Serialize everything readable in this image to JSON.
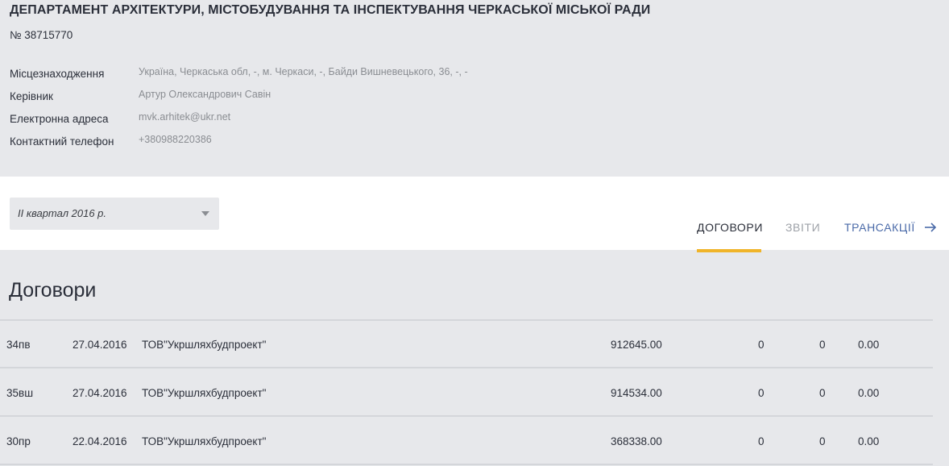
{
  "organization": {
    "title": "ДЕПАРТАМЕНТ АРХІТЕКТУРИ, МІСТОБУДУВАННЯ ТА ІНСПЕКТУВАННЯ ЧЕРКАСЬКОЇ МІСЬКОЇ РАДИ",
    "code": "№ 38715770",
    "details": [
      {
        "label": "Місцезнаходження",
        "value": "Україна, Черкаська обл, -, м. Черкаси, -, Байди Вишневецького, 36, -, -"
      },
      {
        "label": "Керівник",
        "value": "Артур Олександрович Савін"
      },
      {
        "label": "Електронна адреса",
        "value": "mvk.arhitek@ukr.net"
      },
      {
        "label": "Контактний телефон",
        "value": "+380988220386"
      }
    ]
  },
  "filter": {
    "period": "ІІ квартал 2016 р.",
    "caret_icon": "chevron-down-icon"
  },
  "tabs": [
    {
      "label": "ДОГОВОРИ",
      "state": "active",
      "accent": "#f0b429"
    },
    {
      "label": "ЗВІТИ",
      "state": "muted"
    },
    {
      "label": "ТРАНСАКЦІЇ",
      "state": "link",
      "icon": "arrow-right-icon",
      "color": "#4a6aa8"
    }
  ],
  "section": {
    "title": "Договори"
  },
  "contracts": [
    {
      "number": "34пв",
      "date": "27.04.2016",
      "contractor": "ТОВ\"Укршляхбудпроект\"",
      "amount": "912645.00",
      "col_a": "0",
      "col_b": "0",
      "col_c": "0.00"
    },
    {
      "number": "35вш",
      "date": "27.04.2016",
      "contractor": "ТОВ\"Укршляхбудпроект\"",
      "amount": "914534.00",
      "col_a": "0",
      "col_b": "0",
      "col_c": "0.00"
    },
    {
      "number": "30пр",
      "date": "22.04.2016",
      "contractor": "ТОВ\"Укршляхбудпроект\"",
      "amount": "368338.00",
      "col_a": "0",
      "col_b": "0",
      "col_c": "0.00"
    }
  ]
}
